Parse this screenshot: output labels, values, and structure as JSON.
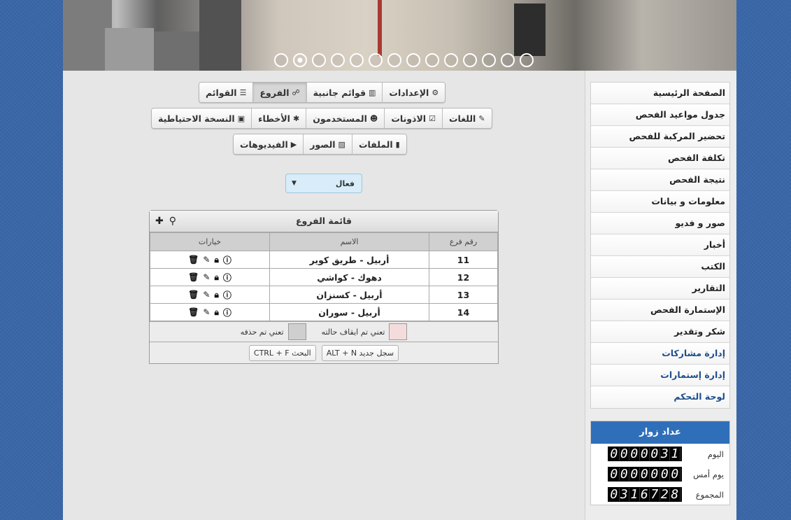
{
  "slider": {
    "dot_count": 14,
    "active_index": 1
  },
  "toolbar": {
    "row1": [
      {
        "name": "settings",
        "label": "الإعدادات",
        "icon": "gear-icon",
        "glyph": "⚙",
        "active": false
      },
      {
        "name": "sidebars",
        "label": "قوائم جانبية",
        "icon": "columns-icon",
        "glyph": "▥",
        "active": false
      },
      {
        "name": "branches",
        "label": "الفروع",
        "icon": "sitemap-icon",
        "glyph": "☍",
        "active": true
      },
      {
        "name": "menus",
        "label": "القوائم",
        "icon": "list-icon",
        "glyph": "☰",
        "active": false
      }
    ],
    "row2": [
      {
        "name": "languages",
        "label": "اللغات",
        "icon": "language-icon",
        "glyph": "✎",
        "active": false
      },
      {
        "name": "permissions",
        "label": "الاذونات",
        "icon": "check-square-icon",
        "glyph": "☑",
        "active": false
      },
      {
        "name": "users",
        "label": "المستخدمون",
        "icon": "users-icon",
        "glyph": "☻",
        "active": false
      },
      {
        "name": "errors",
        "label": "الأخطاء",
        "icon": "bug-icon",
        "glyph": "✱",
        "active": false
      },
      {
        "name": "backup",
        "label": "النسخة الاحتياطية",
        "icon": "briefcase-icon",
        "glyph": "▣",
        "active": false
      }
    ],
    "row3": [
      {
        "name": "files",
        "label": "الملفات",
        "icon": "file-icon",
        "glyph": "▮",
        "active": false
      },
      {
        "name": "images",
        "label": "الصور",
        "icon": "image-icon",
        "glyph": "▨",
        "active": false
      },
      {
        "name": "videos",
        "label": "الفيديوهات",
        "icon": "play-circle-icon",
        "glyph": "▶",
        "active": false
      }
    ]
  },
  "status_select": {
    "value": "فعال",
    "arrow": "▼"
  },
  "branches_panel": {
    "title": "قائمة الفروع",
    "columns": [
      "رقم فرع",
      "الاسم",
      "خيارات"
    ],
    "rows": [
      {
        "number": "11",
        "name": "أربيل - طريق كوير"
      },
      {
        "number": "12",
        "name": "دهوك - كواشي"
      },
      {
        "number": "13",
        "name": "أربيل - كسنزان"
      },
      {
        "number": "14",
        "name": "أربيل - سوران"
      }
    ],
    "legend_suspended": "تعني تم ايقاف حالته",
    "legend_deleted": "تعني تم حذفه",
    "legend_colors": {
      "suspended": "#f5dcdc",
      "deleted": "#cfcfcf"
    },
    "shortcut_new": "ALT + N سجل جديد",
    "shortcut_search": "CTRL + F البحث"
  },
  "menu": [
    {
      "label": "الصفحة الرئيسية",
      "style": "normal"
    },
    {
      "label": "جدول مواعيد الفحص",
      "style": "normal"
    },
    {
      "label": "تحضير المركبة للفحص",
      "style": "normal"
    },
    {
      "label": "تكلفة الفحص",
      "style": "normal"
    },
    {
      "label": "نتيجة الفحص",
      "style": "normal"
    },
    {
      "label": "معلومات و بيانات",
      "style": "normal"
    },
    {
      "label": "صور و فديو",
      "style": "normal"
    },
    {
      "label": "أخبار",
      "style": "normal"
    },
    {
      "label": "الكتب",
      "style": "normal"
    },
    {
      "label": "التقارير",
      "style": "normal"
    },
    {
      "label": "الإستمارة الفحص",
      "style": "normal"
    },
    {
      "label": "شكر وتقدير",
      "style": "normal"
    },
    {
      "label": "إدارة مشاركات",
      "style": "blue"
    },
    {
      "label": "إدارة إستمارات",
      "style": "blue"
    },
    {
      "label": "لوحة التحكم",
      "style": "blue"
    }
  ],
  "visitors": {
    "title": "عداد زوار",
    "rows": [
      {
        "label": "اليوم",
        "value": "0000031"
      },
      {
        "label": "يوم أمس",
        "value": "0000000"
      },
      {
        "label": "المجموع",
        "value": "0316728"
      }
    ]
  },
  "colors": {
    "header_blue": "#2f6fba",
    "link_blue": "#1f4e8c",
    "select_bg": "#d8edf9"
  }
}
